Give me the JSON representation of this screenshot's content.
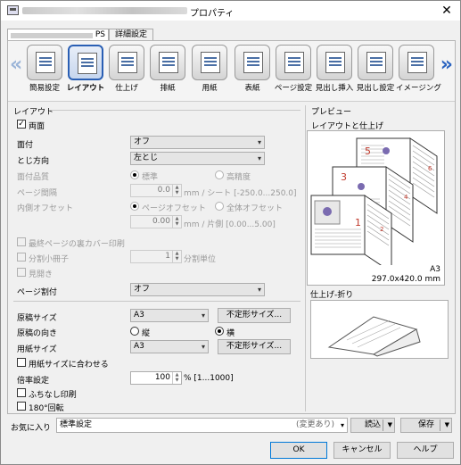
{
  "window": {
    "title": "プロパティ",
    "close": "✕"
  },
  "tabs": [
    {
      "label": "PS"
    },
    {
      "label": "詳細設定"
    }
  ],
  "ribbon": {
    "items": [
      {
        "label": "簡易設定",
        "icon": "quick-setup-icon"
      },
      {
        "label": "レイアウト",
        "icon": "layout-icon",
        "active": true
      },
      {
        "label": "仕上げ",
        "icon": "finishing-icon"
      },
      {
        "label": "排紙",
        "icon": "output-icon"
      },
      {
        "label": "用紙",
        "icon": "paper-icon"
      },
      {
        "label": "表紙",
        "icon": "cover-icon"
      },
      {
        "label": "ページ設定",
        "icon": "page-setup-icon"
      },
      {
        "label": "見出し挿入",
        "icon": "tab-insert-icon"
      },
      {
        "label": "見出し設定",
        "icon": "tab-setting-icon"
      },
      {
        "label": "イメージング",
        "icon": "imaging-icon"
      }
    ],
    "prev": "«",
    "next": "»"
  },
  "layout": {
    "section": "レイアウト",
    "duplex": {
      "label": "両面",
      "checked": true
    },
    "pages_per_sheet": {
      "label": "面付",
      "value": "オフ"
    },
    "binding": {
      "label": "とじ方向",
      "value": "左とじ"
    },
    "quality": {
      "label": "面付品質",
      "opt1": "標準",
      "opt2": "高精度"
    },
    "page_spacing": {
      "label": "ページ間隔",
      "value": "0.0",
      "unit": "mm / シート [-250.0...250.0]"
    },
    "inner_offset": {
      "label": "内側オフセット",
      "opt1": "ページオフセット",
      "opt2": "全体オフセット",
      "value": "0.00",
      "unit": "mm / 片側 [0.00...5.00]"
    },
    "last_page_cover": {
      "label": "最終ページの裏カバー印刷"
    },
    "split_booklet": {
      "label": "分割小冊子",
      "value": "1",
      "unit": "分割単位"
    },
    "spread": {
      "label": "見開き"
    },
    "page_split": {
      "label": "ページ割付",
      "value": "オフ"
    },
    "original_size": {
      "label": "原稿サイズ",
      "value": "A3",
      "button": "不定形サイズ..."
    },
    "orientation": {
      "label": "原稿の向き",
      "opt1": "縦",
      "opt2": "横"
    },
    "paper_size": {
      "label": "用紙サイズ",
      "value": "A3",
      "button": "不定形サイズ..."
    },
    "fit_to_paper": {
      "label": "用紙サイズに合わせる"
    },
    "zoom": {
      "label": "倍率設定",
      "value": "100",
      "unit": "% [1...1000]"
    },
    "borderless": {
      "label": "ふちなし印刷"
    },
    "rotate180": {
      "label": "180°回転"
    }
  },
  "preview": {
    "section": "プレビュー",
    "sub1": "レイアウトと仕上げ",
    "paper_size": "A3",
    "paper_dims": "297.0x420.0 mm",
    "page_numbers": [
      "5",
      "6",
      "3",
      "4",
      "1",
      "2"
    ],
    "sub2": "仕上げ-折り"
  },
  "favorites": {
    "label": "お気に入り",
    "value": "標準設定",
    "changed": "(変更あり)",
    "load": "読込",
    "save": "保存"
  },
  "footer": {
    "ok": "OK",
    "cancel": "キャンセル",
    "help": "ヘルプ"
  }
}
